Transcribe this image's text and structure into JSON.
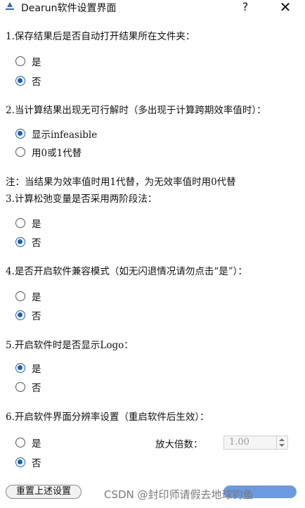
{
  "window": {
    "title": "Dearun软件设置界面",
    "help_label": "?",
    "close_label": "✕"
  },
  "questions": [
    {
      "label": "1.保存结果后是否自动打开结果所在文件夹：",
      "options": [
        "是",
        "否"
      ],
      "selected": "否"
    },
    {
      "label": "2.当计算结果出现无可行解时（多出现于计算跨期效率值时）：",
      "options": [
        "显示infeasible",
        "用0或1代替"
      ],
      "selected": "显示infeasible"
    },
    {
      "label": "3.计算松弛变量是否采用两阶段法：",
      "options": [
        "是",
        "否"
      ],
      "selected": "否"
    },
    {
      "label": "4.是否开启软件兼容模式（如无闪退情况请勿点击“是”）：",
      "options": [
        "是",
        "否"
      ],
      "selected": "否"
    },
    {
      "label": "5.开启软件时是否显示Logo：",
      "options": [
        "是",
        "否"
      ],
      "selected": "是"
    },
    {
      "label": "6.开启软件界面分辨率设置（重启软件后生效）：",
      "options": [
        "是",
        "否"
      ],
      "selected": "否"
    }
  ],
  "note": "注：当结果为效率值时用1代替，为无效率值时用0代替",
  "scale": {
    "label": "放大倍数：",
    "value": "1.00"
  },
  "reset_button": "重置上述设置",
  "watermark": "CSDN @封印师请假去地球钓鱼",
  "colors": {
    "accent": "#1a5fb4"
  }
}
